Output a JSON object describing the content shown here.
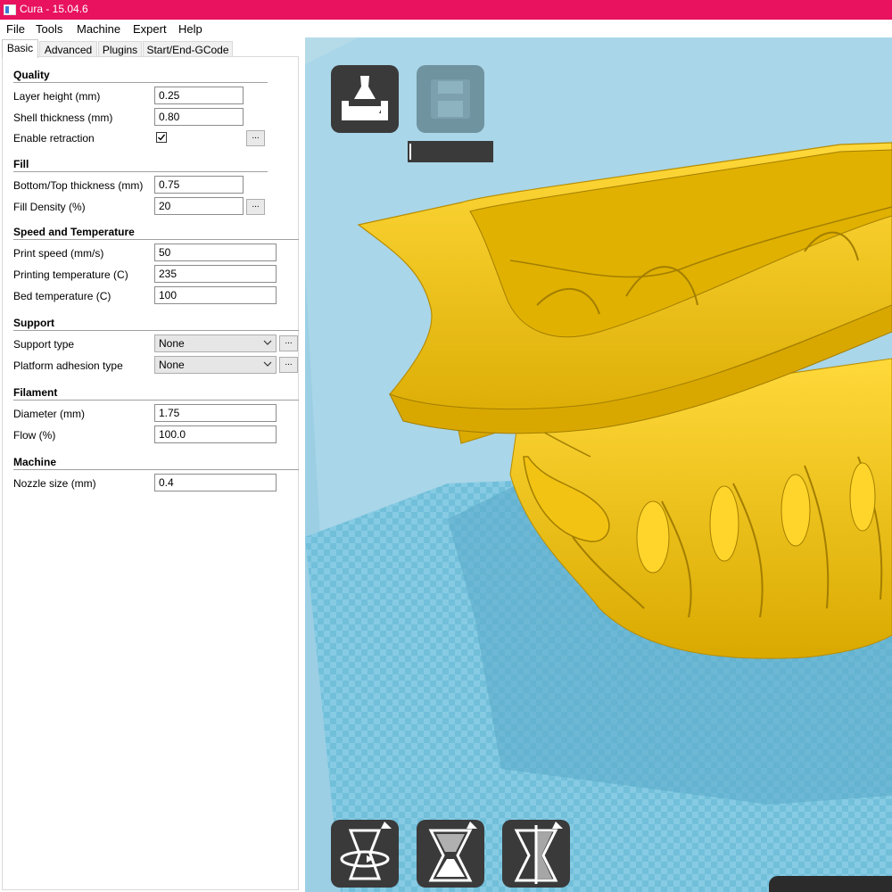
{
  "window": {
    "title": "Cura - 15.04.6"
  },
  "menu": [
    "File",
    "Tools",
    "Machine",
    "Expert",
    "Help"
  ],
  "tabs": [
    "Basic",
    "Advanced",
    "Plugins",
    "Start/End-GCode"
  ],
  "sections": {
    "quality": {
      "title": "Quality",
      "layer_height": {
        "label": "Layer height (mm)",
        "value": "0.25"
      },
      "shell_thickness": {
        "label": "Shell thickness (mm)",
        "value": "0.80"
      },
      "enable_retraction": {
        "label": "Enable retraction",
        "checked": true
      }
    },
    "fill": {
      "title": "Fill",
      "bottom_top": {
        "label": "Bottom/Top thickness (mm)",
        "value": "0.75"
      },
      "fill_density": {
        "label": "Fill Density (%)",
        "value": "20"
      }
    },
    "speed": {
      "title": "Speed and Temperature",
      "print_speed": {
        "label": "Print speed (mm/s)",
        "value": "50"
      },
      "print_temp": {
        "label": "Printing temperature (C)",
        "value": "235"
      },
      "bed_temp": {
        "label": "Bed temperature (C)",
        "value": "100"
      }
    },
    "support": {
      "title": "Support",
      "support_type": {
        "label": "Support type",
        "value": "None"
      },
      "adhesion": {
        "label": "Platform adhesion type",
        "value": "None"
      }
    },
    "filament": {
      "title": "Filament",
      "diameter": {
        "label": "Diameter (mm)",
        "value": "1.75"
      },
      "flow": {
        "label": "Flow (%)",
        "value": "100.0"
      }
    },
    "machine": {
      "title": "Machine",
      "nozzle": {
        "label": "Nozzle size (mm)",
        "value": "0.4"
      }
    }
  },
  "more_button_label": "...",
  "viewport": {
    "colors": {
      "background": "#b5dbe9",
      "build_plate": "#7cc4de",
      "model": "#f0c419",
      "model_shade": "#c99c00"
    },
    "tools_top": [
      "load-model-icon",
      "save-toolpath-icon"
    ],
    "tools_bottom": [
      "rotate-icon",
      "scale-icon",
      "mirror-icon"
    ]
  }
}
